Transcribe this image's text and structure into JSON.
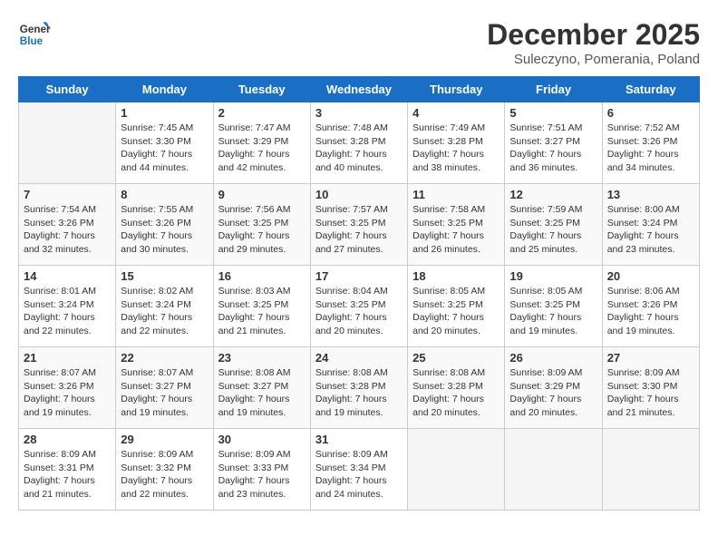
{
  "header": {
    "logo_line1": "General",
    "logo_line2": "Blue",
    "month": "December 2025",
    "location": "Suleczyno, Pomerania, Poland"
  },
  "days_of_week": [
    "Sunday",
    "Monday",
    "Tuesday",
    "Wednesday",
    "Thursday",
    "Friday",
    "Saturday"
  ],
  "weeks": [
    [
      {
        "day": "",
        "info": ""
      },
      {
        "day": "1",
        "info": "Sunrise: 7:45 AM\nSunset: 3:30 PM\nDaylight: 7 hours\nand 44 minutes."
      },
      {
        "day": "2",
        "info": "Sunrise: 7:47 AM\nSunset: 3:29 PM\nDaylight: 7 hours\nand 42 minutes."
      },
      {
        "day": "3",
        "info": "Sunrise: 7:48 AM\nSunset: 3:28 PM\nDaylight: 7 hours\nand 40 minutes."
      },
      {
        "day": "4",
        "info": "Sunrise: 7:49 AM\nSunset: 3:28 PM\nDaylight: 7 hours\nand 38 minutes."
      },
      {
        "day": "5",
        "info": "Sunrise: 7:51 AM\nSunset: 3:27 PM\nDaylight: 7 hours\nand 36 minutes."
      },
      {
        "day": "6",
        "info": "Sunrise: 7:52 AM\nSunset: 3:26 PM\nDaylight: 7 hours\nand 34 minutes."
      }
    ],
    [
      {
        "day": "7",
        "info": "Sunrise: 7:54 AM\nSunset: 3:26 PM\nDaylight: 7 hours\nand 32 minutes."
      },
      {
        "day": "8",
        "info": "Sunrise: 7:55 AM\nSunset: 3:26 PM\nDaylight: 7 hours\nand 30 minutes."
      },
      {
        "day": "9",
        "info": "Sunrise: 7:56 AM\nSunset: 3:25 PM\nDaylight: 7 hours\nand 29 minutes."
      },
      {
        "day": "10",
        "info": "Sunrise: 7:57 AM\nSunset: 3:25 PM\nDaylight: 7 hours\nand 27 minutes."
      },
      {
        "day": "11",
        "info": "Sunrise: 7:58 AM\nSunset: 3:25 PM\nDaylight: 7 hours\nand 26 minutes."
      },
      {
        "day": "12",
        "info": "Sunrise: 7:59 AM\nSunset: 3:25 PM\nDaylight: 7 hours\nand 25 minutes."
      },
      {
        "day": "13",
        "info": "Sunrise: 8:00 AM\nSunset: 3:24 PM\nDaylight: 7 hours\nand 23 minutes."
      }
    ],
    [
      {
        "day": "14",
        "info": "Sunrise: 8:01 AM\nSunset: 3:24 PM\nDaylight: 7 hours\nand 22 minutes."
      },
      {
        "day": "15",
        "info": "Sunrise: 8:02 AM\nSunset: 3:24 PM\nDaylight: 7 hours\nand 22 minutes."
      },
      {
        "day": "16",
        "info": "Sunrise: 8:03 AM\nSunset: 3:25 PM\nDaylight: 7 hours\nand 21 minutes."
      },
      {
        "day": "17",
        "info": "Sunrise: 8:04 AM\nSunset: 3:25 PM\nDaylight: 7 hours\nand 20 minutes."
      },
      {
        "day": "18",
        "info": "Sunrise: 8:05 AM\nSunset: 3:25 PM\nDaylight: 7 hours\nand 20 minutes."
      },
      {
        "day": "19",
        "info": "Sunrise: 8:05 AM\nSunset: 3:25 PM\nDaylight: 7 hours\nand 19 minutes."
      },
      {
        "day": "20",
        "info": "Sunrise: 8:06 AM\nSunset: 3:26 PM\nDaylight: 7 hours\nand 19 minutes."
      }
    ],
    [
      {
        "day": "21",
        "info": "Sunrise: 8:07 AM\nSunset: 3:26 PM\nDaylight: 7 hours\nand 19 minutes."
      },
      {
        "day": "22",
        "info": "Sunrise: 8:07 AM\nSunset: 3:27 PM\nDaylight: 7 hours\nand 19 minutes."
      },
      {
        "day": "23",
        "info": "Sunrise: 8:08 AM\nSunset: 3:27 PM\nDaylight: 7 hours\nand 19 minutes."
      },
      {
        "day": "24",
        "info": "Sunrise: 8:08 AM\nSunset: 3:28 PM\nDaylight: 7 hours\nand 19 minutes."
      },
      {
        "day": "25",
        "info": "Sunrise: 8:08 AM\nSunset: 3:28 PM\nDaylight: 7 hours\nand 20 minutes."
      },
      {
        "day": "26",
        "info": "Sunrise: 8:09 AM\nSunset: 3:29 PM\nDaylight: 7 hours\nand 20 minutes."
      },
      {
        "day": "27",
        "info": "Sunrise: 8:09 AM\nSunset: 3:30 PM\nDaylight: 7 hours\nand 21 minutes."
      }
    ],
    [
      {
        "day": "28",
        "info": "Sunrise: 8:09 AM\nSunset: 3:31 PM\nDaylight: 7 hours\nand 21 minutes."
      },
      {
        "day": "29",
        "info": "Sunrise: 8:09 AM\nSunset: 3:32 PM\nDaylight: 7 hours\nand 22 minutes."
      },
      {
        "day": "30",
        "info": "Sunrise: 8:09 AM\nSunset: 3:33 PM\nDaylight: 7 hours\nand 23 minutes."
      },
      {
        "day": "31",
        "info": "Sunrise: 8:09 AM\nSunset: 3:34 PM\nDaylight: 7 hours\nand 24 minutes."
      },
      {
        "day": "",
        "info": ""
      },
      {
        "day": "",
        "info": ""
      },
      {
        "day": "",
        "info": ""
      }
    ]
  ]
}
